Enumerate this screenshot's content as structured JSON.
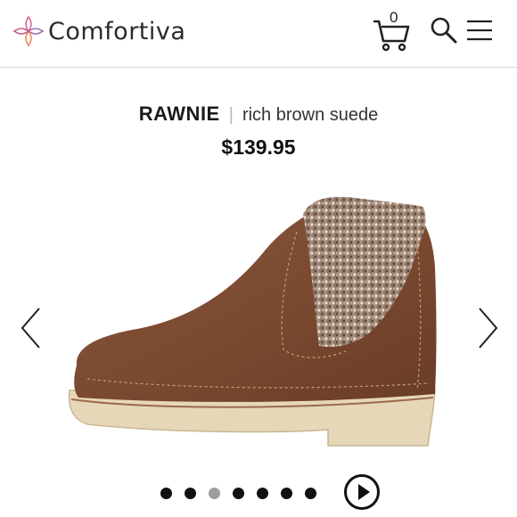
{
  "header": {
    "brand_name": "Comfortiva",
    "cart_count": "0",
    "icons": [
      "logo-mark",
      "cart-icon",
      "search-icon",
      "menu-icon"
    ]
  },
  "product": {
    "name": "RAWNIE",
    "separator": "|",
    "color": "rich brown suede",
    "price": "$139.95"
  },
  "carousel": {
    "total_images": 7,
    "active_index": 2,
    "colors": {
      "dot": "#111111",
      "dot_active": "#9e9e9e"
    }
  },
  "colors": {
    "brand_pink": "#d46a9a",
    "suede_brown": "#7b4a31",
    "sole": "#e6d7b8",
    "text": "#1a1a1a"
  }
}
